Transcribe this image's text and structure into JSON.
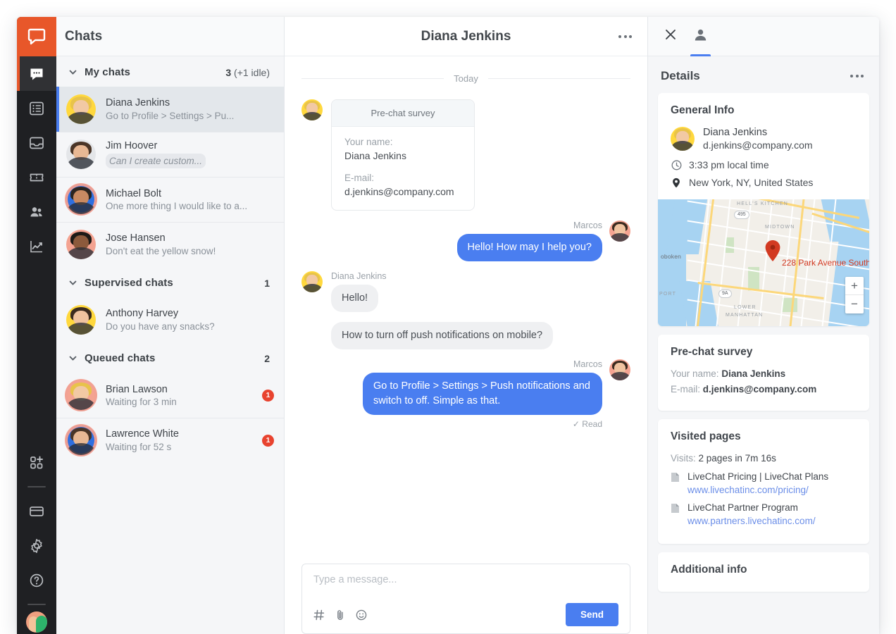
{
  "rail": {
    "logo_icon": "livechat-logo-icon",
    "items": [
      {
        "name": "chats",
        "icon": "chat-bubble-icon",
        "active": true
      },
      {
        "name": "archives",
        "icon": "list-icon",
        "active": false
      },
      {
        "name": "inbox",
        "icon": "inbox-icon",
        "active": false
      },
      {
        "name": "tickets",
        "icon": "ticket-icon",
        "active": false
      },
      {
        "name": "team",
        "icon": "people-icon",
        "active": false
      },
      {
        "name": "reports",
        "icon": "chart-line-icon",
        "active": false
      }
    ],
    "bottom_items": [
      {
        "name": "apps",
        "icon": "apps-add-icon"
      },
      {
        "name": "billing",
        "icon": "credit-card-icon"
      },
      {
        "name": "settings",
        "icon": "gear-icon"
      },
      {
        "name": "help",
        "icon": "help-circle-icon"
      }
    ]
  },
  "chats": {
    "title": "Chats",
    "groups": [
      {
        "label": "My chats",
        "count_main": "3",
        "count_extra": "(+1 idle)",
        "items": [
          {
            "name": "Diana Jenkins",
            "preview": "Go to Profile > Settings > Pu...",
            "selected": true,
            "typing": false,
            "badge": "",
            "avatar_bg": "#FFD83D",
            "ring": false,
            "mini_icon": ""
          },
          {
            "name": "Jim Hoover",
            "preview": "Can I create custom...",
            "selected": false,
            "typing": true,
            "badge": "",
            "avatar_bg": "#e4e6e9",
            "ring": false,
            "mini_icon": ""
          },
          {
            "name": "Michael Bolt",
            "preview": "One more thing I would like to a...",
            "selected": false,
            "typing": false,
            "badge": "",
            "avatar_bg": "#2f6fe0",
            "ring": true,
            "mini_icon": "thumbs-up-icon"
          },
          {
            "name": "Jose Hansen",
            "preview": "Don't eat the yellow snow!",
            "selected": false,
            "typing": false,
            "badge": "",
            "avatar_bg": "#f4a391",
            "ring": false,
            "mini_icon": ""
          }
        ]
      },
      {
        "label": "Supervised chats",
        "count_main": "1",
        "count_extra": "",
        "items": [
          {
            "name": "Anthony Harvey",
            "preview": "Do you have any snacks?",
            "selected": false,
            "typing": false,
            "badge": "",
            "avatar_bg": "#FFD83D",
            "ring": false,
            "mini_icon": ""
          }
        ]
      },
      {
        "label": "Queued chats",
        "count_main": "2",
        "count_extra": "",
        "items": [
          {
            "name": "Brian Lawson",
            "preview": "Waiting for 3 min",
            "selected": false,
            "typing": false,
            "badge": "1",
            "avatar_bg": "#f4a391",
            "ring": true,
            "mini_icon": "messenger-icon"
          },
          {
            "name": "Lawrence White",
            "preview": "Waiting for 52 s",
            "selected": false,
            "typing": false,
            "badge": "1",
            "avatar_bg": "#2f6fe0",
            "ring": true,
            "mini_icon": ""
          }
        ]
      }
    ]
  },
  "conversation": {
    "title": "Diana Jenkins",
    "menu_icon": "more-options-icon",
    "day_separator": "Today",
    "survey": {
      "header": "Pre-chat survey",
      "name_label": "Your name:",
      "name_value": "Diana Jenkins",
      "email_label": "E-mail:",
      "email_value": "d.jenkins@company.com"
    },
    "messages": [
      {
        "sender": "Marcos",
        "text": "Hello! How may I help you?",
        "side": "out",
        "avatar_bg": "#f4a391",
        "status": ""
      },
      {
        "sender": "Diana Jenkins",
        "text": "Hello!",
        "side": "in",
        "avatar_bg": "#FFD83D",
        "status": ""
      },
      {
        "sender": "",
        "text": "How to turn off push notifications on mobile?",
        "side": "in",
        "avatar_bg": "",
        "status": ""
      },
      {
        "sender": "Marcos",
        "text": "Go to Profile > Settings > Push notifications and switch to off. Simple as that.",
        "side": "out",
        "avatar_bg": "#f4a391",
        "status": "✓ Read"
      }
    ],
    "composer": {
      "placeholder": "Type a message...",
      "send_label": "Send",
      "tools": [
        "hash-icon",
        "paperclip-icon",
        "emoji-icon"
      ]
    }
  },
  "details": {
    "tabs": [
      {
        "name": "close",
        "icon": "close-icon",
        "active": false
      },
      {
        "name": "customer-details",
        "icon": "person-icon",
        "active": true
      }
    ],
    "title": "Details",
    "menu_icon": "more-options-icon",
    "general_info": {
      "heading": "General Info",
      "name": "Diana Jenkins",
      "email": "d.jenkins@company.com",
      "time_icon": "clock-icon",
      "time": "3:33 pm local time",
      "location_icon": "map-pin-icon",
      "location": "New York, NY, United States",
      "map": {
        "address": "228 Park Avenue South",
        "labels": [
          "HELL'S KITCHEN",
          "MIDTOWN",
          "oboken",
          "LOWER",
          "MANHATTAN",
          "PORT"
        ],
        "shields": [
          "495",
          "9A"
        ],
        "zoom_in": "+",
        "zoom_out": "−"
      }
    },
    "prechat": {
      "heading": "Pre-chat survey",
      "rows": [
        {
          "label": "Your name:",
          "value": "Diana Jenkins"
        },
        {
          "label": "E-mail:",
          "value": "d.jenkins@company.com"
        }
      ]
    },
    "visited": {
      "heading": "Visited pages",
      "visits_label": "Visits:",
      "visits_value": "2 pages in 7m 16s",
      "pages": [
        {
          "title": "LiveChat Pricing | LiveChat Plans",
          "url": "www.livechatinc.com/pricing/"
        },
        {
          "title": "LiveChat Partner Program",
          "url": "www.partners.livechatinc.com/"
        }
      ]
    },
    "additional": {
      "heading": "Additional info"
    }
  },
  "colors": {
    "brand_orange": "#E8572A",
    "accent_blue": "#4a7ef0",
    "badge_red": "#e8432f",
    "rail_dark": "#1f2023",
    "panel_bg": "#f5f6f8"
  }
}
